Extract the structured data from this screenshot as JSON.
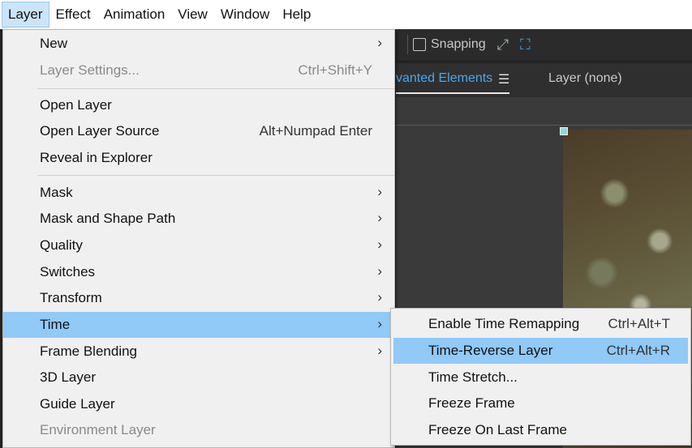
{
  "menubar": {
    "items": [
      "Layer",
      "Effect",
      "Animation",
      "View",
      "Window",
      "Help"
    ],
    "active": "Layer"
  },
  "toolbar": {
    "snapping_label": "Snapping"
  },
  "panel": {
    "tab_active": "vanted Elements",
    "tab_other": "Layer (none)"
  },
  "layer_menu": {
    "items": [
      {
        "label": "New",
        "shortcut": "",
        "submenu": true,
        "disabled": false
      },
      {
        "label": "Layer Settings...",
        "shortcut": "Ctrl+Shift+Y",
        "submenu": false,
        "disabled": true
      },
      {
        "label": "Open Layer",
        "shortcut": "",
        "submenu": false,
        "disabled": false
      },
      {
        "label": "Open Layer Source",
        "shortcut": "Alt+Numpad Enter",
        "submenu": false,
        "disabled": false
      },
      {
        "label": "Reveal in Explorer",
        "shortcut": "",
        "submenu": false,
        "disabled": false
      },
      {
        "label": "Mask",
        "shortcut": "",
        "submenu": true,
        "disabled": false
      },
      {
        "label": "Mask and Shape Path",
        "shortcut": "",
        "submenu": true,
        "disabled": false
      },
      {
        "label": "Quality",
        "shortcut": "",
        "submenu": true,
        "disabled": false
      },
      {
        "label": "Switches",
        "shortcut": "",
        "submenu": true,
        "disabled": false
      },
      {
        "label": "Transform",
        "shortcut": "",
        "submenu": true,
        "disabled": false
      },
      {
        "label": "Time",
        "shortcut": "",
        "submenu": true,
        "disabled": false,
        "highlighted": true
      },
      {
        "label": "Frame Blending",
        "shortcut": "",
        "submenu": true,
        "disabled": false
      },
      {
        "label": "3D Layer",
        "shortcut": "",
        "submenu": false,
        "disabled": false
      },
      {
        "label": "Guide Layer",
        "shortcut": "",
        "submenu": false,
        "disabled": false
      },
      {
        "label": "Environment Layer",
        "shortcut": "",
        "submenu": false,
        "disabled": true
      }
    ]
  },
  "time_submenu": {
    "items": [
      {
        "label": "Enable Time Remapping",
        "shortcut": "Ctrl+Alt+T"
      },
      {
        "label": "Time-Reverse Layer",
        "shortcut": "Ctrl+Alt+R",
        "highlighted": true
      },
      {
        "label": "Time Stretch...",
        "shortcut": ""
      },
      {
        "label": "Freeze Frame",
        "shortcut": ""
      },
      {
        "label": "Freeze On Last Frame",
        "shortcut": ""
      }
    ]
  },
  "colors": {
    "highlight": "#91c9f7",
    "menu_bg": "#f0f0f0",
    "accent_blue": "#4aa6f0"
  },
  "icons": {
    "submenu_arrow": "chevron-right-icon",
    "snapping": "snap-icon",
    "focus": "focus-frame-icon",
    "panel_menu": "hamburger-icon"
  }
}
